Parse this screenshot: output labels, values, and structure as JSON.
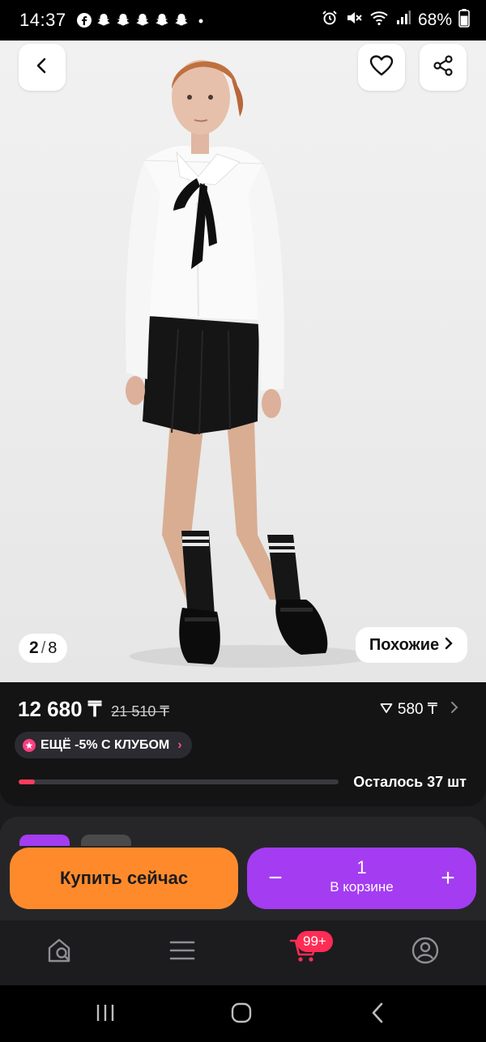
{
  "status_bar": {
    "time": "14:37",
    "battery": "68%",
    "left_icons": [
      "facebook-icon",
      "snapchat-icon",
      "snapchat-icon",
      "snapchat-icon",
      "snapchat-icon",
      "snapchat-icon",
      "dot-icon"
    ],
    "right_icons": [
      "alarm-icon",
      "mute-icon",
      "wifi-icon",
      "signal-icon",
      "battery-icon"
    ]
  },
  "gallery": {
    "current": "2",
    "separator": "/",
    "total": "8",
    "similar_label": "Похожие",
    "similar_icon": "chevron-right-icon",
    "back_icon": "chevron-left-icon",
    "favorite_icon": "heart-icon",
    "share_icon": "share-icon"
  },
  "price": {
    "current": "12 680 ₸",
    "old": "21 510 ₸",
    "drop_value": "580 ₸",
    "drop_icon": "triangle-down-icon"
  },
  "club_promo": {
    "label": "ЕЩЁ -5% С КЛУБОМ",
    "arrow": "›"
  },
  "stock": {
    "label": "Осталось 37 шт",
    "progress_fraction": 0.05
  },
  "actions": {
    "buy_now_label": "Купить сейчас",
    "cart_quantity": "1",
    "cart_label": "В корзине",
    "minus_label": "−",
    "plus_label": "+"
  },
  "tabbar": {
    "items": [
      "home-search-icon",
      "menu-icon",
      "cart-icon",
      "profile-icon"
    ],
    "cart_badge": "99+"
  },
  "system_nav": [
    "recent-apps-icon",
    "home-icon",
    "back-icon"
  ],
  "colors": {
    "buy_button": "#ff8a2c",
    "cart_button": "#a43cf2",
    "badge": "#ff2d55",
    "stock_bar": "#ff3b5c"
  }
}
